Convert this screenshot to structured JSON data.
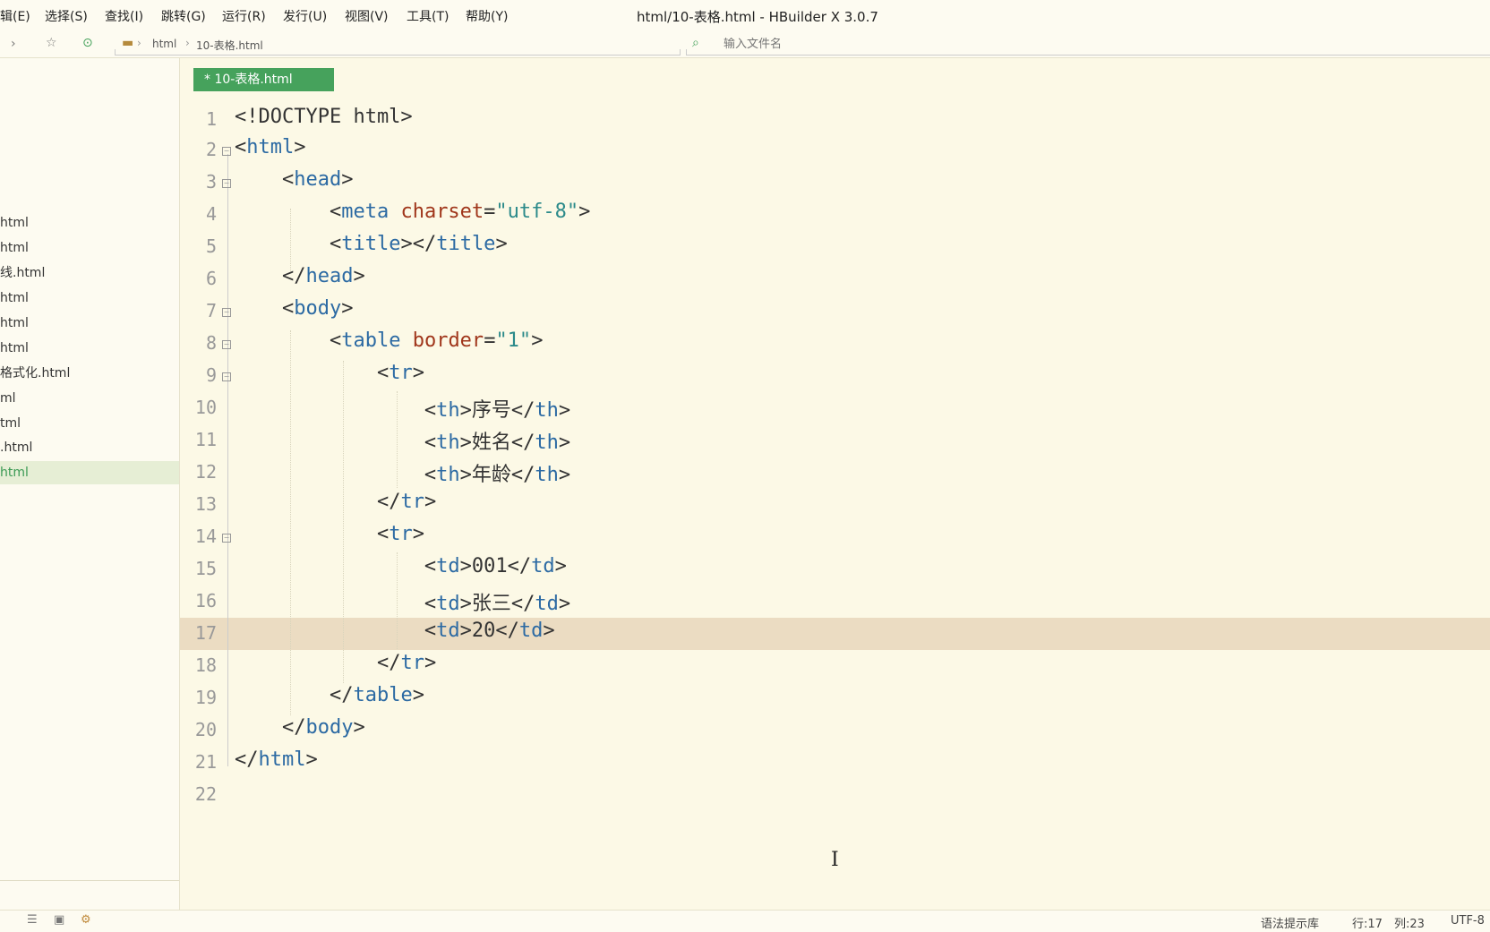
{
  "menubar": {
    "items": [
      "辑(E)",
      "选择(S)",
      "查找(I)",
      "跳转(G)",
      "运行(R)",
      "发行(U)",
      "视图(V)",
      "工具(T)",
      "帮助(Y)"
    ],
    "title": "html/10-表格.html - HBuilder X 3.0.7"
  },
  "toolbar": {
    "breadcrumb": [
      "html",
      "10-表格.html"
    ],
    "search_placeholder": "输入文件名"
  },
  "sidebar": {
    "items": [
      {
        "label": "html"
      },
      {
        "label": "html"
      },
      {
        "label": "线.html"
      },
      {
        "label": "html"
      },
      {
        "label": "html"
      },
      {
        "label": "html"
      },
      {
        "label": "格式化.html"
      },
      {
        "label": "ml"
      },
      {
        "label": "tml"
      },
      {
        "label": ".html"
      },
      {
        "label": "html",
        "active": true
      }
    ]
  },
  "editor": {
    "tab_label": "* 10-表格.html",
    "current_line": 17,
    "lines": [
      "1",
      "2",
      "3",
      "4",
      "5",
      "6",
      "7",
      "8",
      "9",
      "10",
      "11",
      "12",
      "13",
      "14",
      "15",
      "16",
      "17",
      "18",
      "19",
      "20",
      "21",
      "22"
    ]
  },
  "statusbar": {
    "syntax_lib": "语法提示库",
    "row": "行:17",
    "col": "列:23",
    "encoding": "UTF-8"
  },
  "colors": {
    "tag": "#2c6aa3",
    "attribute": "#a0361b",
    "string": "#2b8a8a",
    "tab_active": "#46a25c",
    "current_line": "#ebdcc2",
    "editor_bg": "#fcf9e6"
  }
}
